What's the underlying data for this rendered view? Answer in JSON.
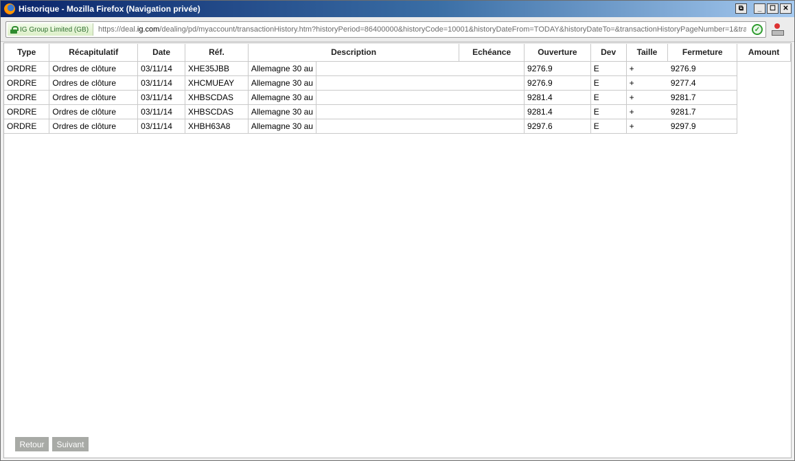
{
  "window": {
    "title": "Historique - Mozilla Firefox (Navigation privée)",
    "buttons": {
      "restore": "⧉",
      "minimize": "_",
      "maximize": "☐",
      "close": "✕"
    }
  },
  "urlbar": {
    "identity": "IG Group Limited (GB)",
    "url_prefix": "https://deal.",
    "url_domain": "ig.com",
    "url_suffix": "/dealing/pd/myaccount/transactionHistory.htm?historyPeriod=86400000&historyCode=10001&historyDateFrom=TODAY&historyDateTo=&transactionHistoryPageNumber=1&tra"
  },
  "table": {
    "columns": [
      "Type",
      "Récapitulatif",
      "Date",
      "Réf.",
      "Description",
      "Echéance",
      "Ouverture",
      "Dev",
      "Taille",
      "Fermeture",
      "Amount"
    ],
    "rows": [
      [
        "ORDRE",
        "Ordres de clôture",
        "03/11/14",
        "XHE35JBB",
        "Allemagne 30 au",
        "",
        "9276.9",
        "E",
        "+",
        "9276.9",
        ""
      ],
      [
        "ORDRE",
        "Ordres de clôture",
        "03/11/14",
        "XHCMUEAY",
        "Allemagne 30 au",
        "",
        "9276.9",
        "E",
        "+",
        "9277.4",
        ""
      ],
      [
        "ORDRE",
        "Ordres de clôture",
        "03/11/14",
        "XHBSCDAS",
        "Allemagne 30 au",
        "",
        "9281.4",
        "E",
        "+",
        "9281.7",
        ""
      ],
      [
        "ORDRE",
        "Ordres de clôture",
        "03/11/14",
        "XHBSCDAS",
        "Allemagne 30 au",
        "",
        "9281.4",
        "E",
        "+",
        "9281.7",
        ""
      ],
      [
        "ORDRE",
        "Ordres de clôture",
        "03/11/14",
        "XHBH63A8",
        "Allemagne 30 au",
        "",
        "9297.6",
        "E",
        "+",
        "9297.9",
        ""
      ]
    ]
  },
  "pagination": {
    "back_label": "Retour",
    "next_label": "Suivant"
  }
}
